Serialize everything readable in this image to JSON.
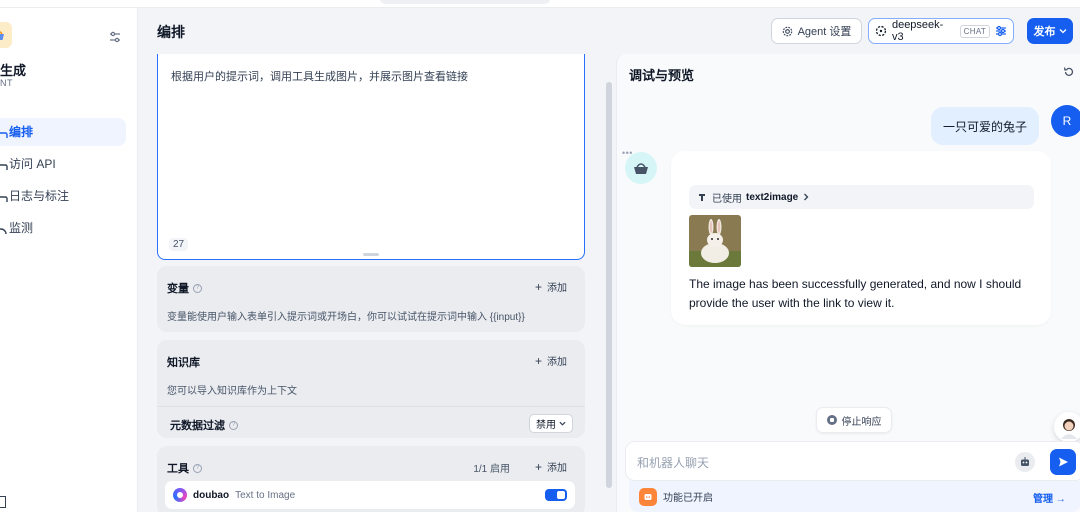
{
  "sidebar": {
    "app_name": "生成",
    "app_type": "NT",
    "items": [
      {
        "label": "编排",
        "active": true,
        "icon": "layout-icon"
      },
      {
        "label": "访问 API",
        "active": false,
        "icon": "terminal-icon"
      },
      {
        "label": "日志与标注",
        "active": false,
        "icon": "file-text-icon"
      },
      {
        "label": "监测",
        "active": false,
        "icon": "chart-icon"
      }
    ]
  },
  "header": {
    "title": "编排",
    "agent_settings_label": "Agent 设置",
    "model_name": "deepseek-v3",
    "model_badge": "CHAT",
    "publish_label": "发布"
  },
  "config": {
    "prompt_text": "根据用户的提示词，调用工具生成图片，并展示图片查看链接",
    "prompt_count": "27",
    "variables": {
      "title": "变量",
      "add_label": "添加",
      "description": "变量能使用户输入表单引入提示词或开场白，你可以试试在提示词中输入 {{input}}"
    },
    "knowledge": {
      "title": "知识库",
      "add_label": "添加",
      "description": "您可以导入知识库作为上下文",
      "meta_filter_label": "元数据过滤",
      "meta_filter_value": "禁用"
    },
    "tools": {
      "title": "工具",
      "count_label": "1/1 启用",
      "add_label": "添加",
      "items": [
        {
          "provider": "doubao",
          "name": "Text to Image",
          "enabled": true
        }
      ]
    }
  },
  "preview": {
    "title": "调试与预览",
    "user_avatar_letter": "R",
    "user_message": "一只可爱的兔子",
    "tool_used_prefix": "已使用",
    "tool_used_name": "text2image",
    "bot_message": "The image has been successfully generated, and now I should provide the user with the link to view it.",
    "stop_label": "停止响应",
    "input_placeholder": "和机器人聊天",
    "feature_status": "功能已开启",
    "manage_label": "管理 →"
  },
  "colors": {
    "accent": "#155eef",
    "background": "#f2f4f7",
    "user_bubble": "#e1effe",
    "feature_icon": "#fd853a"
  }
}
